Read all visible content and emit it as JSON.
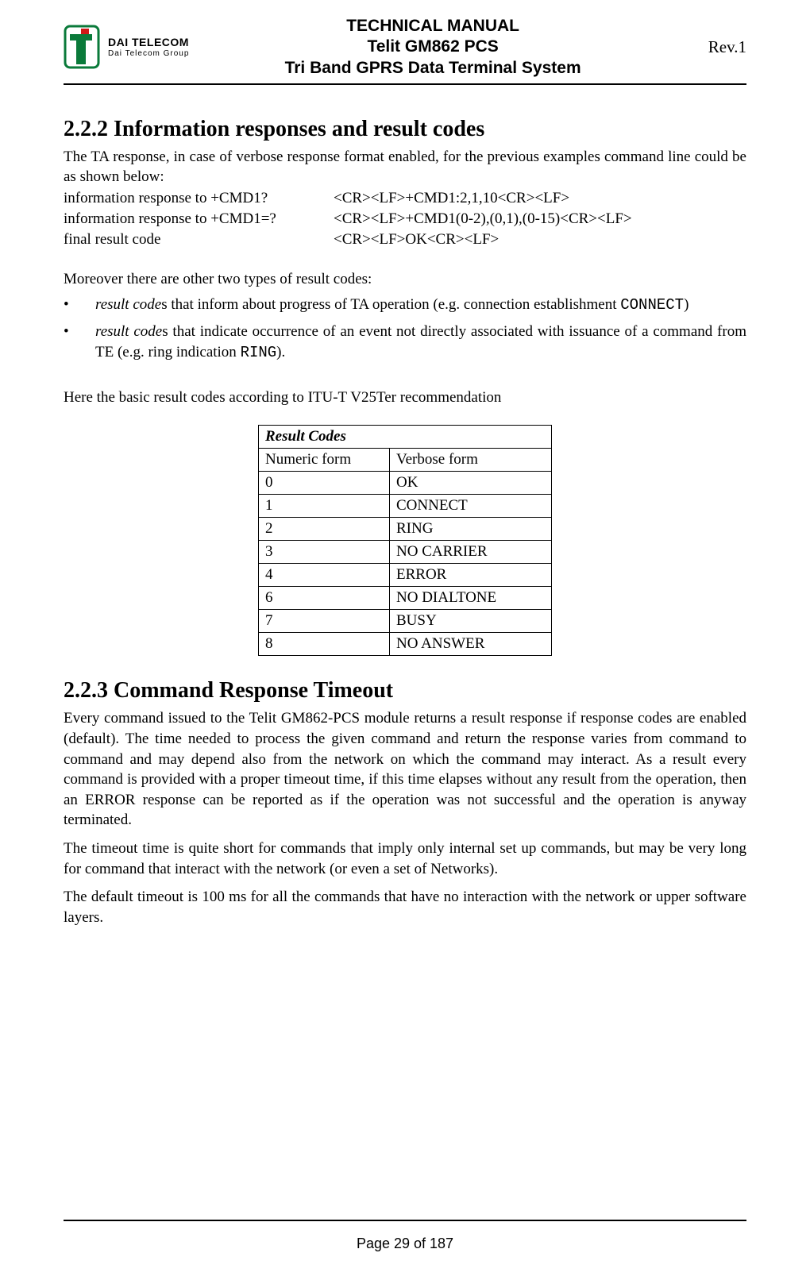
{
  "header": {
    "logo": {
      "line1": "DAI TELECOM",
      "line2": "Dai Telecom Group"
    },
    "title_line1": "TECHNICAL MANUAL",
    "title_line2": "Telit GM862 PCS",
    "title_line3": "Tri Band GPRS Data Terminal System",
    "revision": "Rev.1"
  },
  "section222": {
    "heading": "2.2.2 Information responses and result codes",
    "intro": "The TA response, in case of verbose response format enabled, for the previous examples command line could be as shown below:",
    "rows": [
      {
        "label": "information response to +CMD1?",
        "value": "<CR><LF>+CMD1:2,1,10<CR><LF>"
      },
      {
        "label": "information response to +CMD1=?",
        "value": "<CR><LF>+CMD1(0-2),(0,1),(0-15)<CR><LF>"
      },
      {
        "label": "final result code",
        "value": "<CR><LF>OK<CR><LF>"
      }
    ],
    "moreover": "Moreover there are other two types of result codes:",
    "bullets": [
      {
        "prefix_italic": "result code",
        "suffix": "s that inform about progress of TA operation (e.g. connection establishment ",
        "mono": "CONNECT",
        "tail": ")"
      },
      {
        "prefix_italic": "result code",
        "suffix": "s that indicate occurrence of an event not directly associated with issuance of a command from TE (e.g. ring indication ",
        "mono": "RING",
        "tail": ")."
      }
    ],
    "basic_intro": "Here the basic result codes according to ITU-T V25Ter recommendation",
    "table": {
      "title": "Result Codes",
      "col1": "Numeric form",
      "col2": "Verbose form",
      "rows": [
        {
          "numeric": "0",
          "verbose": "OK"
        },
        {
          "numeric": "1",
          "verbose": "CONNECT"
        },
        {
          "numeric": "2",
          "verbose": "RING"
        },
        {
          "numeric": "3",
          "verbose": "NO CARRIER"
        },
        {
          "numeric": "4",
          "verbose": "ERROR"
        },
        {
          "numeric": "6",
          "verbose": "NO DIALTONE"
        },
        {
          "numeric": "7",
          "verbose": "BUSY"
        },
        {
          "numeric": "8",
          "verbose": "NO ANSWER"
        }
      ]
    }
  },
  "section223": {
    "heading": "2.2.3 Command Response Timeout",
    "p1": "Every command issued to the Telit GM862-PCS module returns a result response if response codes are enabled (default). The time needed to process the given command and return the response varies from command to command and may depend also from the network on which the command may interact. As a result every command is provided with a proper timeout time, if this time elapses without any result from the operation, then an ERROR response can be reported as if the operation was not successful and the operation is anyway terminated.",
    "p2": "The timeout time is quite short for commands that imply only internal set up commands, but may be very long for command that interact with the network (or even a set of Networks).",
    "p3": "The default timeout is 100 ms for all the commands that have no interaction with the network or upper software layers."
  },
  "footer": {
    "page": "Page 29 of 187"
  }
}
